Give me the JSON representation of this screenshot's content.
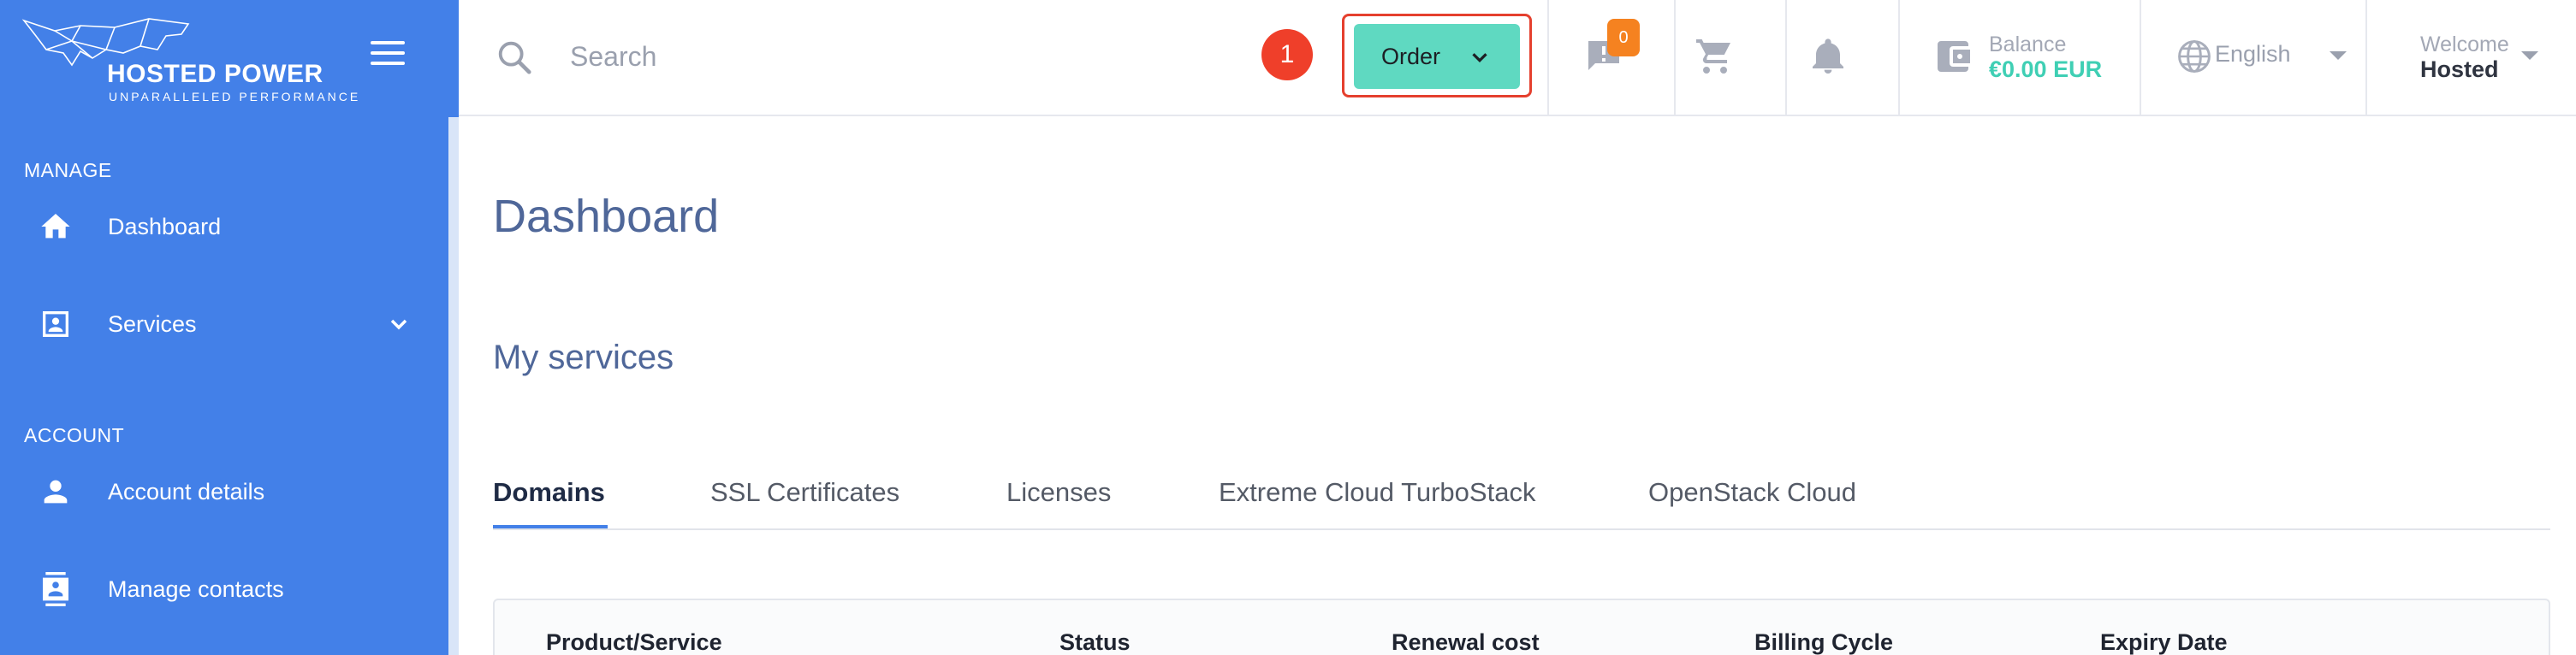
{
  "brand": {
    "name": "HOSTED POWER",
    "tagline": "UNPARALLELED PERFORMANCE"
  },
  "sidebar": {
    "sections": [
      {
        "title": "MANAGE",
        "items": [
          {
            "label": "Dashboard",
            "icon": "home-icon"
          },
          {
            "label": "Services",
            "icon": "contact-card-icon",
            "has_submenu": true
          }
        ]
      },
      {
        "title": "ACCOUNT",
        "items": [
          {
            "label": "Account details",
            "icon": "person-icon"
          },
          {
            "label": "Manage contacts",
            "icon": "contacts-icon"
          }
        ]
      }
    ]
  },
  "header": {
    "search": {
      "placeholder": "Search",
      "value": ""
    },
    "step_badge": "1",
    "order_label": "Order",
    "messages_count": "0",
    "balance": {
      "caption": "Balance",
      "value": "€0.00 EUR"
    },
    "language": "English",
    "welcome": {
      "caption": "Welcome",
      "name": "Hosted"
    }
  },
  "main": {
    "title": "Dashboard",
    "section_heading": "My services",
    "tabs": [
      {
        "label": "Domains",
        "active": true
      },
      {
        "label": "SSL Certificates"
      },
      {
        "label": "Licenses"
      },
      {
        "label": "Extreme Cloud TurboStack"
      },
      {
        "label": "OpenStack Cloud"
      }
    ],
    "table": {
      "columns": [
        "Product/Service",
        "Status",
        "Renewal cost",
        "Billing Cycle",
        "Expiry Date"
      ]
    }
  },
  "colors": {
    "sidebar": "#4380e8",
    "accent_teal": "#5fd9c1",
    "highlight_red": "#e5402e",
    "badge_orange": "#f58220",
    "title_blue": "#4f6799"
  }
}
